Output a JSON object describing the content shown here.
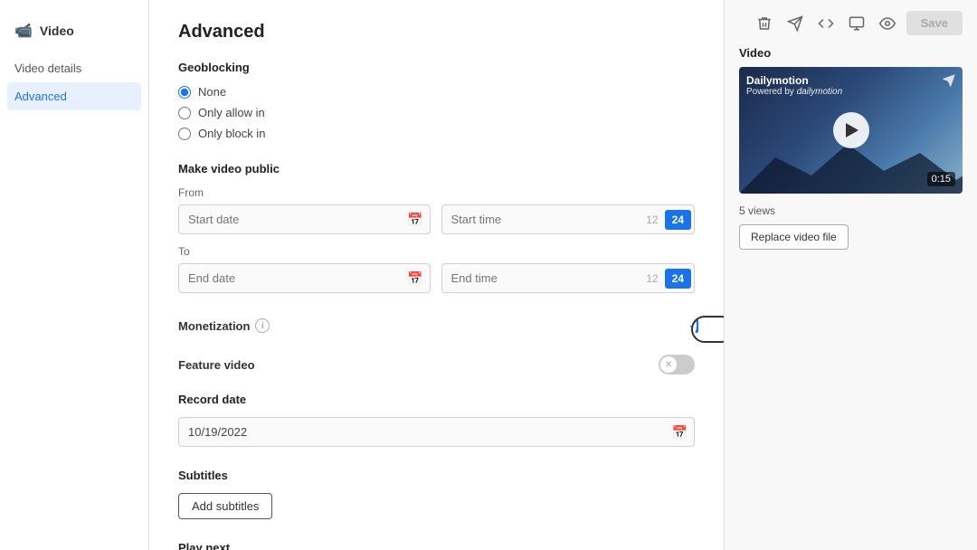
{
  "sidebar": {
    "header": {
      "icon": "🎬",
      "label": "Video"
    },
    "items": [
      {
        "id": "video-details",
        "label": "Video details",
        "active": false
      },
      {
        "id": "advanced",
        "label": "Advanced",
        "active": true
      }
    ]
  },
  "main": {
    "page_title": "Advanced",
    "geoblocking": {
      "title": "Geoblocking",
      "options": [
        {
          "id": "none",
          "label": "None",
          "checked": true
        },
        {
          "id": "only-allow",
          "label": "Only allow in",
          "checked": false
        },
        {
          "id": "only-block",
          "label": "Only block in",
          "checked": false
        }
      ]
    },
    "make_public": {
      "title": "Make video public",
      "from_label": "From",
      "to_label": "To",
      "start_date_placeholder": "Start date",
      "start_time_placeholder": "Start time",
      "start_time_number": "12",
      "start_time_badge": "24",
      "end_date_placeholder": "End date",
      "end_time_placeholder": "End time",
      "end_time_number": "12",
      "end_time_badge": "24"
    },
    "monetization": {
      "label": "Monetization",
      "enabled": true
    },
    "feature_video": {
      "label": "Feature video",
      "enabled": false
    },
    "record_date": {
      "label": "Record date",
      "value": "10/19/2022"
    },
    "subtitles": {
      "label": "Subtitles",
      "add_button": "Add subtitles"
    },
    "play_next": {
      "label": "Play next"
    }
  },
  "right_panel": {
    "toolbar": {
      "icons": [
        "trash",
        "send",
        "code",
        "download",
        "eye"
      ],
      "save_label": "Save"
    },
    "video": {
      "label": "Video",
      "brand_name": "Dailymotion",
      "brand_sub": "Powered by dailymotion",
      "duration": "0:15",
      "views": "5 views",
      "replace_button": "Replace video file"
    }
  },
  "colors": {
    "accent": "#1a73e8",
    "save_disabled": "#e0e0e0",
    "active_bg": "#e8f0fe"
  }
}
